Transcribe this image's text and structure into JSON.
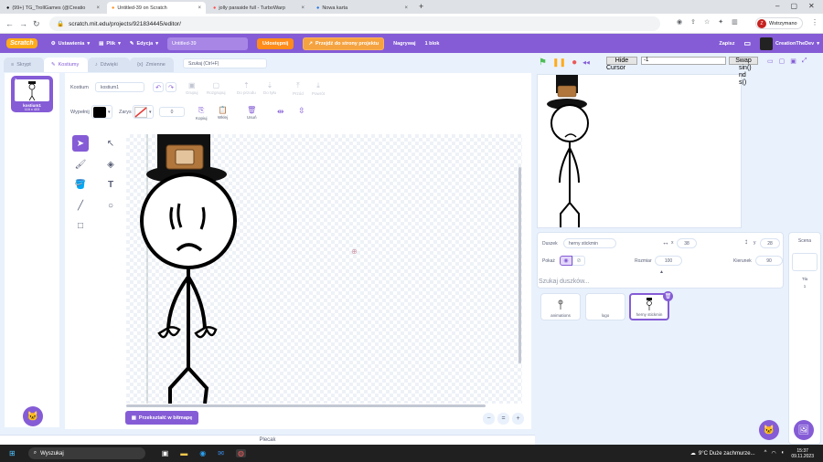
{
  "browser": {
    "tabs": [
      {
        "label": "(99+) TG_TrollGames (@Creatio",
        "active": false
      },
      {
        "label": "Untitled-39 on Scratch",
        "active": true
      },
      {
        "label": "jolly paraside full - TurboWarp",
        "active": false
      },
      {
        "label": "Nowa karta",
        "active": false
      }
    ],
    "new_tab": "+",
    "url": "scratch.mit.edu/projects/921834445/editor/",
    "profile": "Wstrzymano"
  },
  "menu": {
    "logo": "Scratch",
    "settings": "Ustawienia",
    "file": "Plik",
    "edit": "Edycja",
    "title": "Untitled-39",
    "share": "Udostępnij",
    "see_project": "Przejdź do strony projektu",
    "record": "Nagrywaj",
    "blocks": "1 blok",
    "save": "Zapisz",
    "user": "CreationTheDev"
  },
  "editor_tabs": {
    "code": "Skrypt",
    "costumes": "Kostiumy",
    "sounds": "Dźwięki",
    "vars": "Zmienne"
  },
  "search": {
    "placeholder": "Szukaj (Ctrl+F)"
  },
  "costume": {
    "number": "1",
    "card_name": "kostium1",
    "card_size": "116 x 403",
    "label": "Kostium",
    "name": "kostium1",
    "fill_label": "Wypełnij",
    "outline_label": "Zarys",
    "outline_width": "0",
    "tools": {
      "group": "Grupuj",
      "ungroup": "Rozgrupuj",
      "forward": "Do przodu",
      "back": "Do tyłu",
      "front": "Przód",
      "back2": "Powrót",
      "copy": "Kopiuj",
      "paste": "Wklej",
      "delete": "Usuń"
    }
  },
  "bitmap_button": "Przekształć w bitmapę",
  "zoom": {
    "out": "−",
    "reset": "=",
    "in": "+"
  },
  "backpack": "Plecak",
  "stage_overlay": {
    "hide": "Hide",
    "cursor": "Cursor",
    "value": "-1",
    "swap": "Swap",
    "line1": "sin()",
    "line2": "nd",
    "line3": "s()"
  },
  "sprite_info": {
    "sprite_label": "Duszek",
    "sprite_name": "herny stickmin",
    "x_label": "x",
    "x": "38",
    "y_label": "y",
    "y": "28",
    "show_label": "Pokaż",
    "size_label": "Rozmiar",
    "size": "100",
    "dir_label": "Kierunek",
    "dir": "90"
  },
  "sprite_search": "Szukaj duszków...",
  "sprites": [
    {
      "name": "animations",
      "selected": false
    },
    {
      "name": "logo",
      "selected": false
    },
    {
      "name": "herny stickmin",
      "selected": true
    }
  ],
  "stage_panel": {
    "label": "Scena",
    "backdrops_label": "Tła",
    "backdrops": "1"
  },
  "taskbar": {
    "search": "Wyszukaj",
    "weather": "9°C  Duże zachmurze...",
    "time": "15:37",
    "date": "09.11.2023"
  },
  "colors": {
    "accent": "#855cd6",
    "orange": "#ff8c1a",
    "fill": "#000000"
  }
}
